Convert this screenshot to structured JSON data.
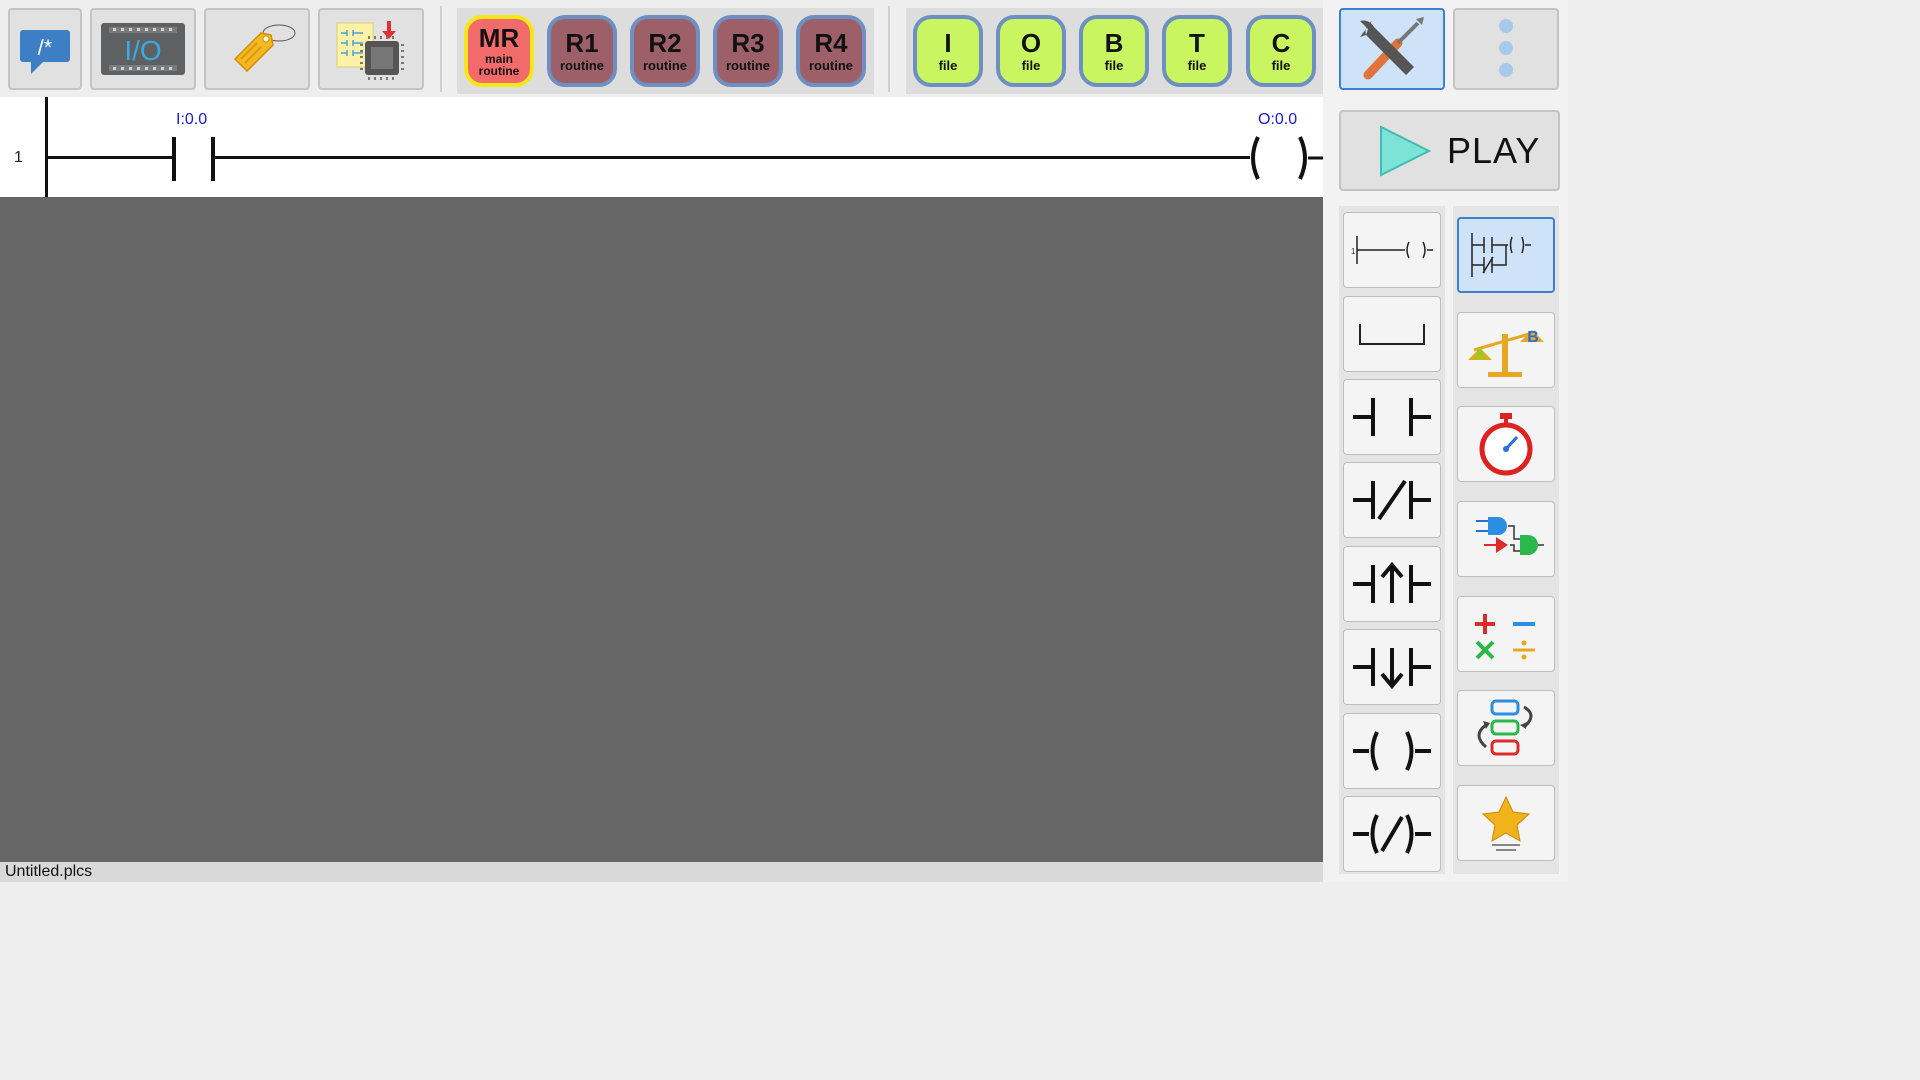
{
  "toolbar": {
    "comment_icon_text": "/*",
    "io_icon_text": "I/O"
  },
  "routines": [
    {
      "code": "MR",
      "label_line1": "main",
      "label_line2": "routine",
      "active": true
    },
    {
      "code": "R1",
      "label": "routine"
    },
    {
      "code": "R2",
      "label": "routine"
    },
    {
      "code": "R3",
      "label": "routine"
    },
    {
      "code": "R4",
      "label": "routine"
    }
  ],
  "files": [
    {
      "code": "I",
      "label": "file"
    },
    {
      "code": "O",
      "label": "file"
    },
    {
      "code": "B",
      "label": "file"
    },
    {
      "code": "T",
      "label": "file"
    },
    {
      "code": "C",
      "label": "file"
    }
  ],
  "play_label": "PLAY",
  "rung": {
    "number": "1",
    "contact_tag": "I:0.0",
    "coil_tag": "O:0.0"
  },
  "status_bar": {
    "filename": "Untitled.plcs"
  },
  "palette_icons": {
    "left": [
      "rung-icon",
      "branch-icon",
      "no-contact-icon",
      "nc-contact-icon",
      "rising-edge-contact-icon",
      "falling-edge-contact-icon",
      "coil-icon",
      "negated-coil-icon"
    ],
    "right": [
      "ladder-basic-icon",
      "compare-scale-icon",
      "timer-stopwatch-icon",
      "logic-gates-icon",
      "math-operators-icon",
      "program-flow-icon",
      "favorites-star-icon"
    ]
  },
  "colors": {
    "canvas": "#666666",
    "routine_active": "#f26a6a",
    "routine": "#9e6068",
    "file": "#c8f560",
    "tag_text": "#1a1ad6"
  }
}
